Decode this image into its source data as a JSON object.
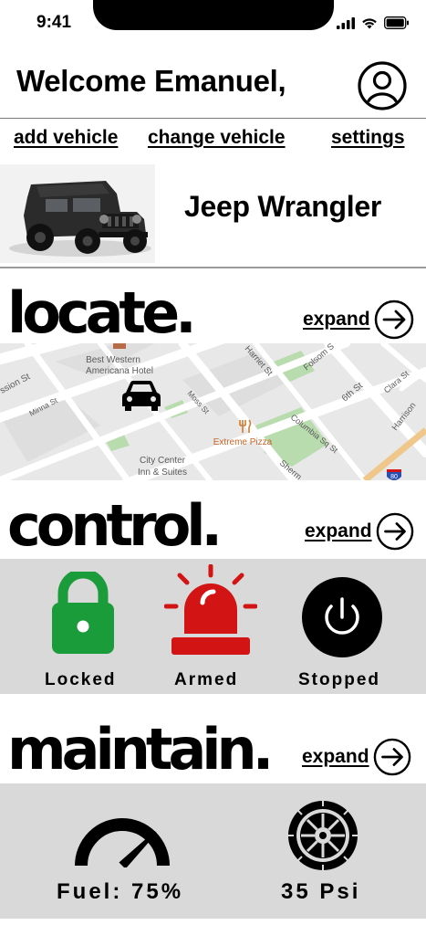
{
  "status_bar": {
    "time": "9:41"
  },
  "header": {
    "welcome": "Welcome Emanuel,"
  },
  "nav": {
    "add_vehicle": "add vehicle",
    "change_vehicle": "change vehicle",
    "settings": "settings"
  },
  "vehicle": {
    "name": "Jeep Wrangler"
  },
  "locate": {
    "title": "locate.",
    "expand_label": "expand",
    "map_labels": {
      "hotel": "Best Western Americana Hotel",
      "hotel_line1": "Best Western",
      "hotel_line2": "Americana Hotel",
      "pizza": "Extreme Pizza",
      "inn_line1": "City Center",
      "inn_line2": "Inn & Suites",
      "street_mission": "ssion St",
      "street_minna": "Minna St",
      "street_moss": "Moss St",
      "street_harriet": "Harriet St",
      "street_folsom": "Folsom S",
      "street_6th": "6th St",
      "street_clara": "Clara St",
      "street_harrison": "Harrison",
      "street_columbia": "Columbia Sq St",
      "street_sherman": "Sherm",
      "highway": "80"
    }
  },
  "control": {
    "title": "control.",
    "expand_label": "expand",
    "lock_status": "Locked",
    "alarm_status": "Armed",
    "engine_status": "Stopped",
    "colors": {
      "lock": "#1a9c3a",
      "alarm": "#d21414",
      "engine": "#000000"
    }
  },
  "maintain": {
    "title": "maintain.",
    "expand_label": "expand",
    "fuel_label": "Fuel: 75%",
    "fuel_level": 75,
    "tire_label": "35 Psi"
  },
  "icons": [
    "profile-icon",
    "signal-icon",
    "wifi-icon",
    "battery-icon",
    "arrow-right-icon",
    "lock-icon",
    "alarm-siren-icon",
    "power-icon",
    "fuel-gauge-icon",
    "tire-icon",
    "car-icon",
    "restaurant-icon",
    "hotel-icon"
  ]
}
